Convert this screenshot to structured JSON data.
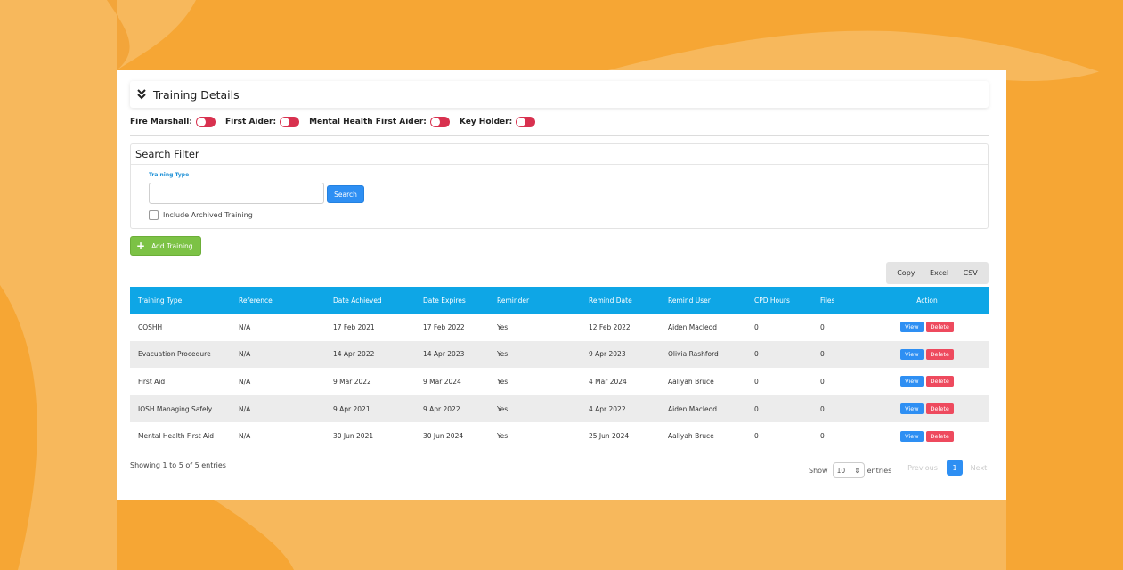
{
  "colors": {
    "background": "#f7b85c",
    "blob": "#f6a634",
    "header_blue": "#0ea6e6",
    "button_blue": "#2e8ff3",
    "add_green": "#7cc245",
    "delete_red": "#ee4a5e",
    "toggle_red": "#d8314f"
  },
  "panel": {
    "title": "Training Details",
    "icon": "chevron-double-down-icon"
  },
  "toggles": [
    {
      "label": "Fire Marshall:",
      "on": false
    },
    {
      "label": "First Aider:",
      "on": false
    },
    {
      "label": "Mental Health First Aider:",
      "on": false
    },
    {
      "label": "Key Holder:",
      "on": false
    }
  ],
  "filter": {
    "title": "Search Filter",
    "training_type_label": "Training Type",
    "training_type_value": "",
    "search_label": "Search",
    "include_archived_label": "Include Archived Training",
    "include_archived_checked": false
  },
  "actions": {
    "add_training_label": "Add Training",
    "add_icon": "plus-icon"
  },
  "export": {
    "copy": "Copy",
    "excel": "Excel",
    "csv": "CSV"
  },
  "table": {
    "headers": [
      "Training Type",
      "Reference",
      "Date Achieved",
      "Date Expires",
      "Reminder",
      "Remind Date",
      "Remind User",
      "CPD Hours",
      "Files",
      "Action"
    ],
    "view_label": "View",
    "delete_label": "Delete",
    "rows": [
      {
        "type": "COSHH",
        "reference": "N/A",
        "achieved": "17 Feb 2021",
        "expires": "17 Feb 2022",
        "reminder": "Yes",
        "remind_date": "12 Feb 2022",
        "remind_user": "Aiden Macleod",
        "cpd": "0",
        "files": "0"
      },
      {
        "type": "Evacuation Procedure",
        "reference": "N/A",
        "achieved": "14 Apr 2022",
        "expires": "14 Apr 2023",
        "reminder": "Yes",
        "remind_date": "9 Apr 2023",
        "remind_user": "Olivia Rashford",
        "cpd": "0",
        "files": "0"
      },
      {
        "type": "First Aid",
        "reference": "N/A",
        "achieved": "9 Mar 2022",
        "expires": "9 Mar 2024",
        "reminder": "Yes",
        "remind_date": "4 Mar 2024",
        "remind_user": "Aaliyah Bruce",
        "cpd": "0",
        "files": "0"
      },
      {
        "type": "IOSH Managing Safely",
        "reference": "N/A",
        "achieved": "9 Apr 2021",
        "expires": "9 Apr 2022",
        "reminder": "Yes",
        "remind_date": "4 Apr 2022",
        "remind_user": "Aiden Macleod",
        "cpd": "0",
        "files": "0"
      },
      {
        "type": "Mental Health First Aid",
        "reference": "N/A",
        "achieved": "30 Jun 2021",
        "expires": "30 Jun 2024",
        "reminder": "Yes",
        "remind_date": "25 Jun 2024",
        "remind_user": "Aaliyah Bruce",
        "cpd": "0",
        "files": "0"
      }
    ]
  },
  "footer": {
    "showing": "Showing 1 to 5 of 5 entries",
    "show_label": "Show",
    "page_length": "10",
    "entries_label": "entries",
    "previous": "Previous",
    "current_page": "1",
    "next": "Next"
  }
}
